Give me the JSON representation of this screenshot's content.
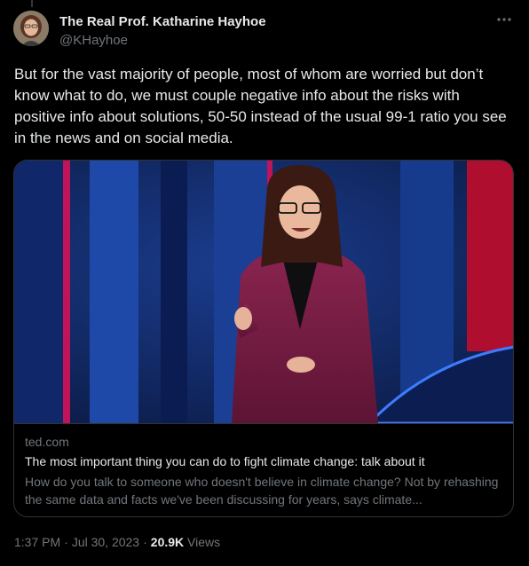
{
  "author": {
    "name": "The Real Prof. Katharine Hayhoe",
    "handle": "@KHayhoe"
  },
  "tweet": {
    "text": "But for the vast majority of people, most of whom are worried but don’t know what to do, we must couple negative info about the risks with positive info about solutions, 50-50 instead of the usual 99-1 ratio you see in the news and on social media."
  },
  "link_card": {
    "domain": "ted.com",
    "title": "The most important thing you can do to fight climate change: talk about it",
    "description": "How do you talk to someone who doesn't believe in climate change? Not by rehashing the same data and facts we've been discussing for years, says climate..."
  },
  "meta": {
    "time": "1:37 PM",
    "separator": "·",
    "date": "Jul 30, 2023",
    "views_count": "20.9K",
    "views_label": "Views"
  },
  "icons": {
    "more": "more-icon"
  },
  "colors": {
    "background": "#000000",
    "text": "#e7e9ea",
    "muted": "#71767b",
    "border": "#2f3336"
  }
}
